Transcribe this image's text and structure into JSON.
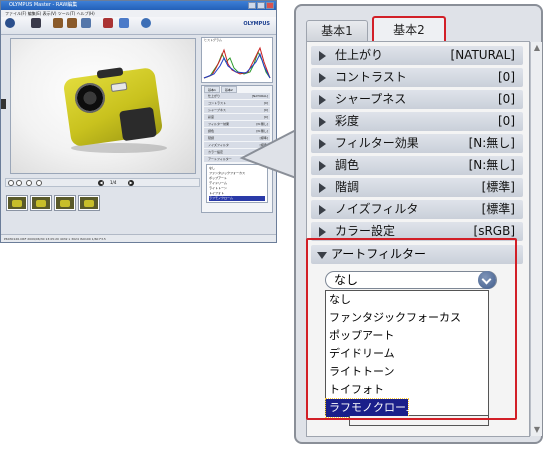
{
  "app": {
    "title": "OLYMPUS Master - RAW編集",
    "menu": "ファイル(F)  編集(E)  表示(V)  ツール(T)  ヘルプ(H)",
    "logo": "OLYMPUS",
    "histogram_label": "ヒストグラム",
    "mini_tabs": [
      "基本1",
      "基本2"
    ],
    "mini_rows": [
      {
        "label": "仕上がり",
        "value": "[NATURAL]"
      },
      {
        "label": "コントラスト",
        "value": "[0]"
      },
      {
        "label": "シャープネス",
        "value": "[0]"
      },
      {
        "label": "彩度",
        "value": "[0]"
      },
      {
        "label": "フィルター効果",
        "value": "[N:無し]"
      },
      {
        "label": "調色",
        "value": "[N:無し]"
      },
      {
        "label": "階調",
        "value": "[標準]"
      },
      {
        "label": "ノイズフィルタ",
        "value": "[標準]"
      },
      {
        "label": "カラー設定",
        "value": "[sRGB]"
      },
      {
        "label": "アートフィルター",
        "value": ""
      }
    ],
    "zoom_value": "1/4",
    "status": "P6030126.ORF  2009/06/30 13:05:20  4032 x 3024  ISO100  1/60  F3.5"
  },
  "panel": {
    "tabs": [
      {
        "label": "基本1",
        "active": false
      },
      {
        "label": "基本2",
        "active": true
      }
    ],
    "rows": [
      {
        "label": "仕上がり",
        "value": "[NATURAL]"
      },
      {
        "label": "コントラスト",
        "value": "[0]"
      },
      {
        "label": "シャープネス",
        "value": "[0]"
      },
      {
        "label": "彩度",
        "value": "[0]"
      },
      {
        "label": "フィルター効果",
        "value": "[N:無し]"
      },
      {
        "label": "調色",
        "value": "[N:無し]"
      },
      {
        "label": "階調",
        "value": "[標準]"
      },
      {
        "label": "ノイズフィルタ",
        "value": "[標準]"
      },
      {
        "label": "カラー設定",
        "value": "[sRGB]"
      }
    ],
    "art_filter": {
      "label": "アートフィルター",
      "selected_value": "なし",
      "options": [
        "なし",
        "ファンタジックフォーカス",
        "ポップアート",
        "デイドリーム",
        "ライトトーン",
        "トイフォト",
        "ラフモノクローム"
      ],
      "highlighted_index": 6
    }
  },
  "colors": {
    "highlight": "#d21f27",
    "selection": "#1a1f8a"
  }
}
